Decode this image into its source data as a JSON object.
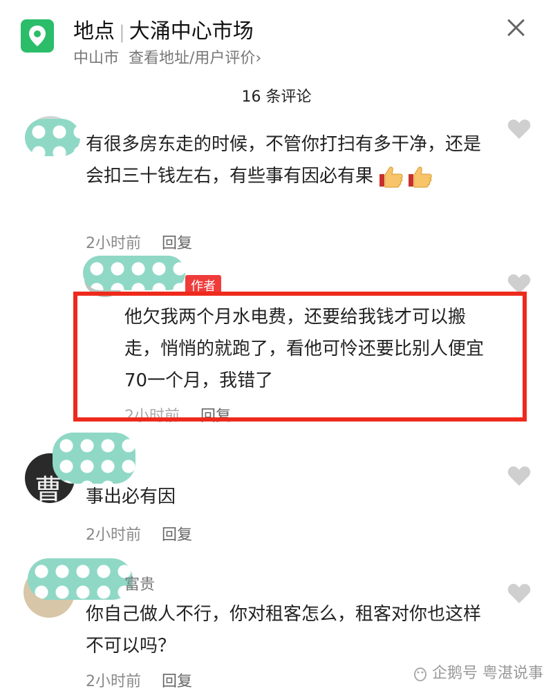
{
  "header": {
    "place_label": "地点",
    "place_name": "大涌中心市场",
    "city": "中山市",
    "address_link": "查看地址/用户评价",
    "chevron": "›"
  },
  "comment_count": "16 条评论",
  "comments": [
    {
      "text": "有很多房东走的时候，不管你打扫有多干净，还是会扣三十钱左右，有些事有因必有果",
      "emoji": [
        "thumbs-up",
        "thumbs-up"
      ],
      "time": "2小时前",
      "reply": "回复"
    },
    {
      "author_tag": "作者",
      "text": "他欠我两个月水电费，还要给我钱才可以搬走，悄悄的就跑了，看他可怜还要比别人便宜70一个月，我错了",
      "time": "2小时前",
      "reply": "回复"
    },
    {
      "avatar_char": "曹",
      "text": "事出必有因",
      "time": "2小时前",
      "reply": "回复"
    },
    {
      "name_tail": "富贵",
      "text": "你自己做人不行，你对租客怎么，租客对你也这样不可以吗？",
      "time": "2小时前",
      "reply": "回复"
    }
  ],
  "watermark": "企鹅号 粤湛说事",
  "colors": {
    "location_green": "#2bbd6a",
    "author_tag_red": "#f03b3b",
    "highlight_border": "#ee2a1c",
    "mosaic_teal": "#8fd8c6"
  }
}
